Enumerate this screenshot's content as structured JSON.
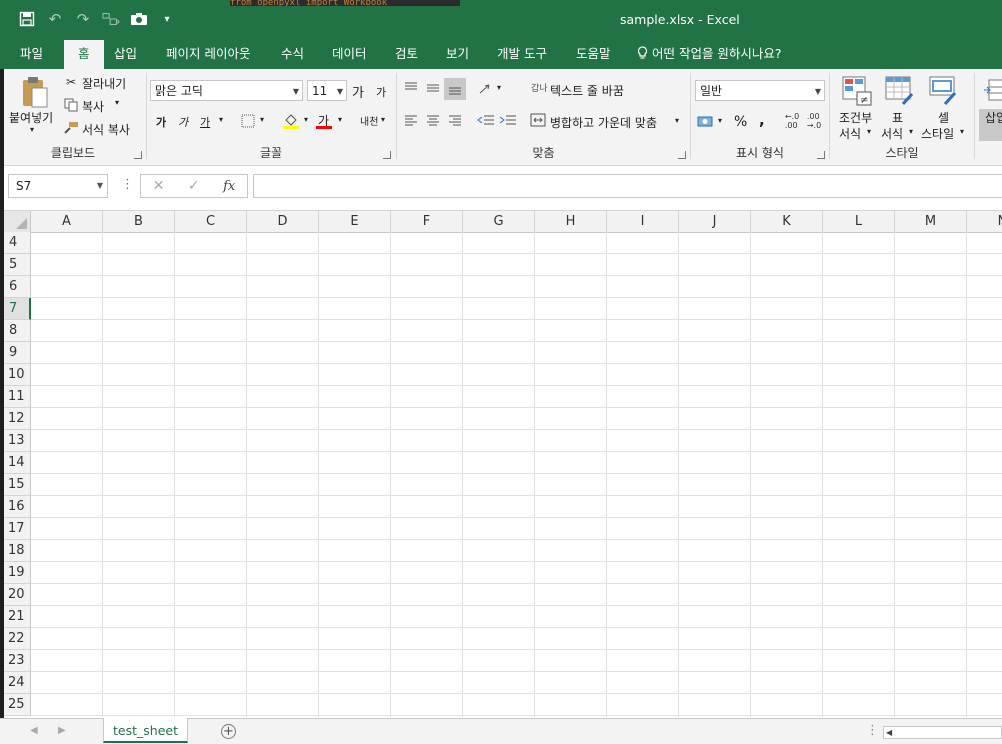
{
  "window": {
    "title": "sample.xlsx  -  Excel",
    "background_strip": "from openpyxl import Workbook",
    "accent": "#217346"
  },
  "qat": {
    "icons": [
      "save-icon",
      "undo-icon",
      "redo-icon",
      "touch-mode-icon",
      "camera-icon",
      "customize-qat-icon"
    ]
  },
  "menu": {
    "tabs": [
      "파일",
      "홈",
      "삽입",
      "페이지 레이아웃",
      "수식",
      "데이터",
      "검토",
      "보기",
      "개발 도구",
      "도움말"
    ],
    "tell_me": "어떤 작업을 원하시나요?"
  },
  "ribbon": {
    "clipboard": {
      "paste": "붙여넣기",
      "cut": "잘라내기",
      "copy": "복사",
      "format_painter": "서식 복사",
      "label": "클립보드"
    },
    "font": {
      "font_name": "맑은 고딕",
      "font_size": "11",
      "grow": "가",
      "shrink": "가",
      "bold": "가",
      "italic": "가",
      "underline": "가",
      "font_color": "가",
      "phonetic": "내천",
      "label": "글꼴",
      "fill_color": "#ffff00",
      "text_color": "#ff0000"
    },
    "alignment": {
      "wrap_text": "텍스트 줄 바꿈",
      "merge_center": "병합하고 가운데 맞춤",
      "wrap_icon_text": "갑나",
      "label": "맞춤"
    },
    "number": {
      "format": "일반",
      "percent": "%",
      "comma": ",",
      "label": "표시 형식"
    },
    "styles": {
      "conditional_top": "조건부",
      "conditional_bottom": "서식",
      "table_top": "표",
      "table_bottom": "서식",
      "cell_top": "셀",
      "cell_bottom": "스타일",
      "label": "스타일"
    },
    "cells": {
      "insert": "삽입"
    }
  },
  "formula_bar": {
    "name_box": "S7",
    "cancel": "✕",
    "enter": "✓",
    "fx": "fx",
    "value": ""
  },
  "sheet": {
    "columns": [
      "A",
      "B",
      "C",
      "D",
      "E",
      "F",
      "G",
      "H",
      "I",
      "J",
      "K",
      "L",
      "M",
      "N"
    ],
    "rows": [
      "4",
      "5",
      "6",
      "7",
      "8",
      "9",
      "10",
      "11",
      "12",
      "13",
      "14",
      "15",
      "16",
      "17",
      "18",
      "19",
      "20",
      "21",
      "22",
      "23",
      "24",
      "25"
    ],
    "selected_row": "7"
  },
  "sheet_tabs": {
    "tabs": [
      "test_sheet"
    ],
    "prev": "◀",
    "next": "▶",
    "add": "+"
  }
}
